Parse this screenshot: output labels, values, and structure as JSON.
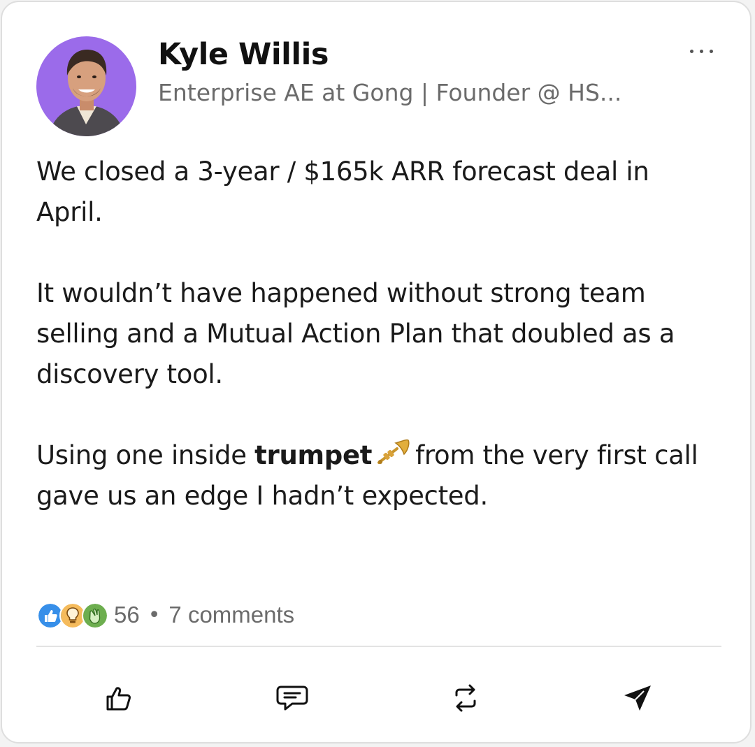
{
  "author": {
    "name": "Kyle Willis",
    "headline": "Enterprise AE at Gong | Founder @ HS...",
    "avatar_bg": "#9b6bea"
  },
  "post": {
    "paragraph1": {
      "line1": "We closed a 3-year / $165k ARR forecast deal in",
      "line2": "April."
    },
    "paragraph2": {
      "line1": "It wouldn’t have happened without strong team",
      "line2": "selling and a Mutual Action Plan that doubled as a",
      "line3": "discovery tool."
    },
    "paragraph3": {
      "prefix": "Using one inside",
      "bold_word": "trumpet",
      "emoji_icon": "trumpet-icon",
      "suffix": "from the very first call",
      "line2": "gave us an edge I hadn’t expected."
    }
  },
  "social": {
    "reaction_icons": [
      "like-icon",
      "insightful-icon",
      "celebrate-icon"
    ],
    "reaction_colors": {
      "like": "#378fe9",
      "insightful": "#f5bb5c",
      "celebrate": "#6dae4f"
    },
    "reaction_count": "56",
    "separator": "•",
    "comments": "7 comments"
  },
  "actions": {
    "icons": [
      "like-icon",
      "comment-icon",
      "repost-icon",
      "send-icon"
    ]
  }
}
